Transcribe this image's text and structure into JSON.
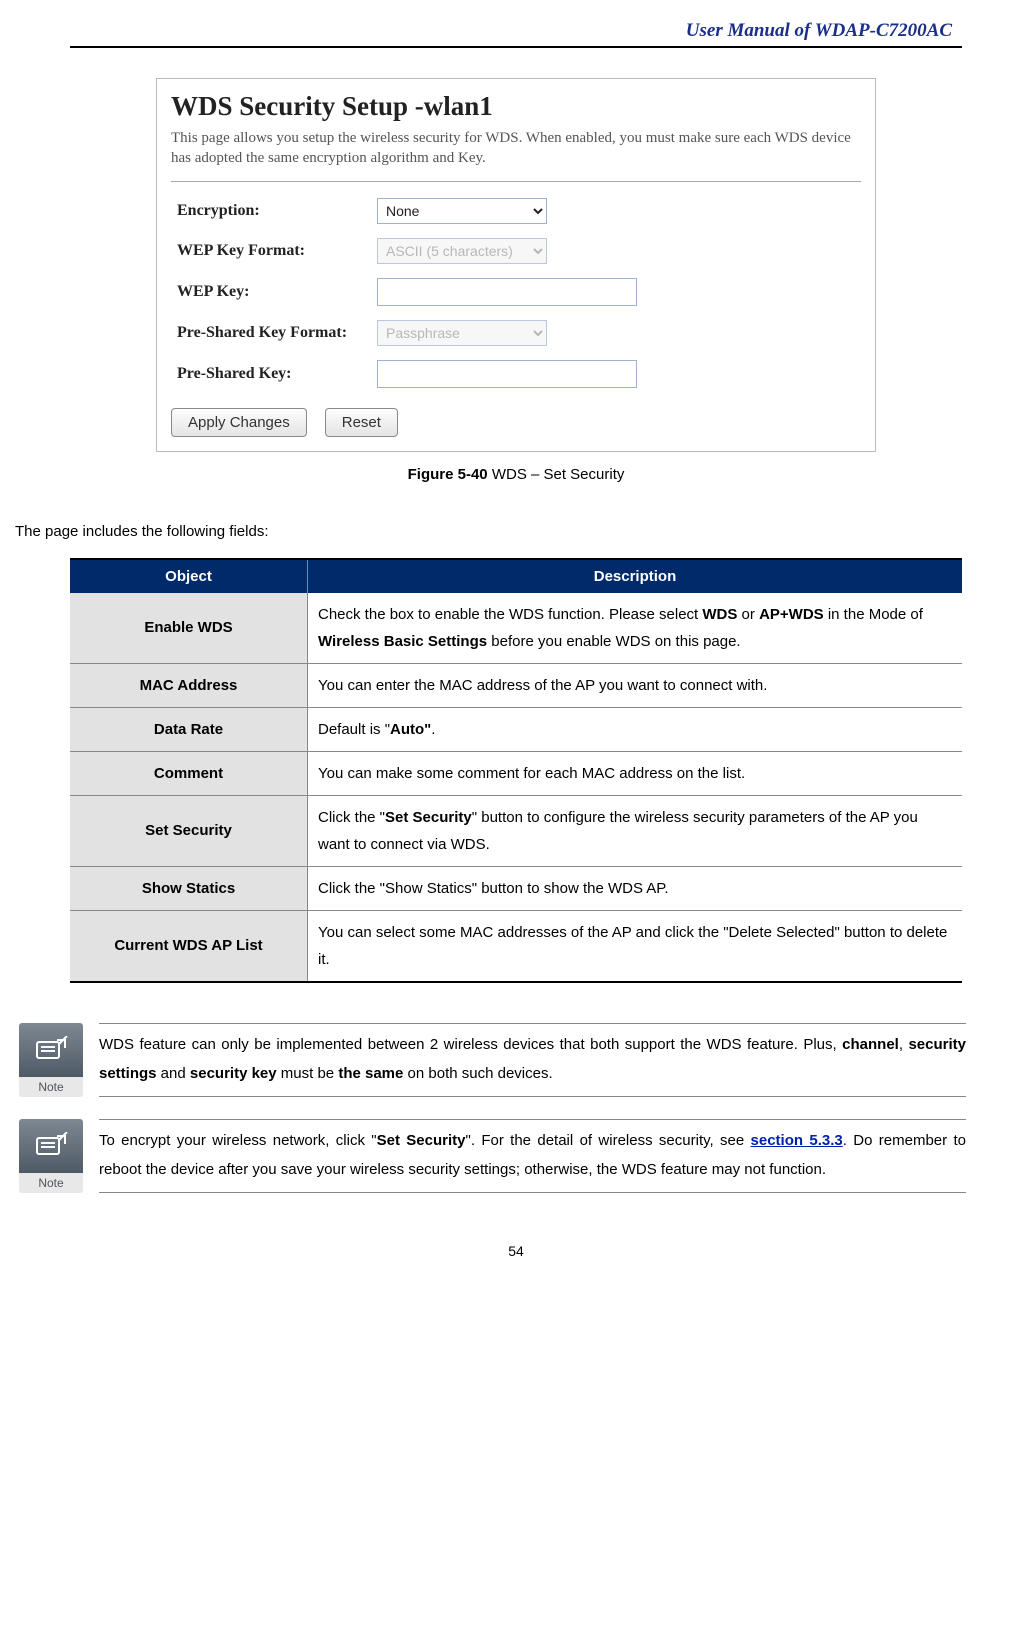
{
  "header": {
    "title": "User Manual of WDAP-C7200AC"
  },
  "screenshot": {
    "title": "WDS Security Setup -wlan1",
    "intro": "This page allows you setup the wireless security for WDS. When enabled, you must make sure each WDS device has adopted the same encryption algorithm and Key.",
    "labels": {
      "encryption": "Encryption:",
      "wep_format": "WEP Key Format:",
      "wep_key": "WEP Key:",
      "psk_format": "Pre-Shared Key Format:",
      "psk_key": "Pre-Shared Key:"
    },
    "values": {
      "encryption": "None",
      "wep_format": "ASCII (5 characters)",
      "wep_key": "",
      "psk_format": "Passphrase",
      "psk_key": ""
    },
    "buttons": {
      "apply": "Apply Changes",
      "reset": "Reset"
    }
  },
  "caption": {
    "bold": "Figure 5-40",
    "rest": " WDS – Set Security"
  },
  "lead": "The page includes the following fields:",
  "table": {
    "headers": {
      "object": "Object",
      "description": "Description"
    },
    "rows": [
      {
        "object": "Enable WDS",
        "desc": "Check the box to enable the WDS function. Please select <b>WDS</b> or <b>AP+WDS</b> in the Mode of <b>Wireless Basic Settings</b> before you enable WDS on this page."
      },
      {
        "object": "MAC Address",
        "desc": "You can enter the MAC address of the AP you want to connect with."
      },
      {
        "object": "Data Rate",
        "desc": "Default is \"<b>Auto\"</b>."
      },
      {
        "object": "Comment",
        "desc": "You can make some comment for each MAC address on the list."
      },
      {
        "object": "Set Security",
        "desc": "Click the \"<b>Set Security</b>\" button to configure the wireless security parameters of the AP you want to connect via WDS."
      },
      {
        "object": "Show Statics",
        "desc": "Click the \"Show Statics\" button to show the WDS AP."
      },
      {
        "object": "Current WDS AP List",
        "desc": "You can select some MAC addresses of the AP and click the \"Delete Selected\" button to delete it."
      }
    ]
  },
  "notes": [
    {
      "label": "Note",
      "html": "WDS feature can only be implemented between 2 wireless devices that both support the WDS feature. Plus, <b>channel</b>, <b>security settings</b> and <b>security key</b> must be <b>the same</b> on both such devices."
    },
    {
      "label": "Note",
      "html": "To encrypt your wireless network, click \"<b>Set Security</b>\". For the detail of wireless security, see <a href=\"#\">section 5.3.3</a>. Do remember to reboot the device after you save your wireless security settings; otherwise, the WDS feature may not function."
    }
  ],
  "footer": {
    "page": "54"
  }
}
